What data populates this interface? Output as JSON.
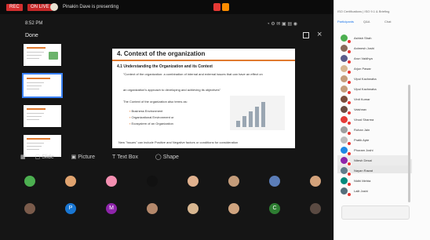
{
  "topbar": {
    "rec_label": "REC",
    "live_label": "ON LIVE",
    "presenting_text": "Pinakin Dave is presenting"
  },
  "stage": {
    "time": "8:52 PM",
    "done_label": "Done",
    "thumbnails": [
      {
        "index": 1,
        "selected": false
      },
      {
        "index": 2,
        "selected": true
      },
      {
        "index": 3,
        "selected": false
      },
      {
        "index": 4,
        "selected": false
      }
    ],
    "slide": {
      "title": "4. Context of the organization",
      "subtitle": "4.1 Understanding the Organization and its Context",
      "p1": "\"Context of the organization: a combination of internal and external issues that can have an effect on",
      "p2": "an organization's approach to developing and achieving its objectives\"",
      "p3": "The Context of the organization also terms as:",
      "bullets": [
        "Business Environment",
        "Organizational Environment or",
        "Ecosystem of an Organization"
      ],
      "footnote": "New \"Issues\" can include Positive and Negative factors or conditions for consideration"
    },
    "toolbar": [
      "Slide",
      "Picture",
      "Text Box",
      "Shape"
    ]
  },
  "participants_row1": [
    {
      "color": "#4caf50",
      "initial": ""
    },
    {
      "color": "#e0a36f",
      "initial": ""
    },
    {
      "color": "#f48fb1",
      "initial": ""
    },
    {
      "color": "#111111",
      "initial": ""
    },
    {
      "color": "#e0b18e",
      "initial": ""
    },
    {
      "color": "#c49c7a",
      "initial": ""
    },
    {
      "color": "#5b7db8",
      "initial": ""
    },
    {
      "color": "#d3a27b",
      "initial": ""
    },
    {
      "color": "#8a6a5a",
      "initial": ""
    }
  ],
  "participants_row2": [
    {
      "color": "#7a5b4b",
      "initial": ""
    },
    {
      "color": "#1976d2",
      "initial": "P"
    },
    {
      "color": "#8e24aa",
      "initial": "M"
    },
    {
      "color": "#b4886b",
      "initial": ""
    },
    {
      "color": "#d7b690",
      "initial": ""
    },
    {
      "color": "#cfa47f",
      "initial": ""
    },
    {
      "color": "#2e7d32",
      "initial": "C"
    },
    {
      "color": "#5a4a42",
      "initial": ""
    }
  ],
  "right_panel": {
    "title": "ISO Certifications | ISO 9.1 & Briefing",
    "tabs": [
      {
        "label": "Participants",
        "active": true
      },
      {
        "label": "Q&A",
        "active": false
      },
      {
        "label": "Chat",
        "active": false
      }
    ],
    "participants": [
      {
        "name": "Ashish Shah",
        "color": "#4caf50"
      },
      {
        "name": "Animesh Joshi",
        "color": "#8a6a5a"
      },
      {
        "name": "Arun Vaidhya",
        "color": "#5b5b8a"
      },
      {
        "name": "Arjun Pawar",
        "color": "#d7b690"
      },
      {
        "name": "Vipul Kachwaha",
        "color": "#c49c7a"
      },
      {
        "name": "Vipul Kachwaha",
        "color": "#c49c7a"
      },
      {
        "name": "Vinit Kumar",
        "color": "#7a4b3a"
      },
      {
        "name": "Vaishnav",
        "color": "#6d4c41"
      },
      {
        "name": "Vinod Sharma",
        "color": "#e53935"
      },
      {
        "name": "Rohan Jain",
        "color": "#9e9e9e"
      },
      {
        "name": "Pratik Apte",
        "color": "#bdbdbd"
      },
      {
        "name": "Phoram Joshi",
        "color": "#1e88e5"
      },
      {
        "name": "Nitesh Desai",
        "color": "#8e24aa"
      },
      {
        "name": "Nayan Rawat",
        "color": "#607d8b"
      },
      {
        "name": "Nidhi Mehta",
        "color": "#00897b"
      },
      {
        "name": "Lalit Joshi",
        "color": "#546e7a"
      }
    ]
  }
}
